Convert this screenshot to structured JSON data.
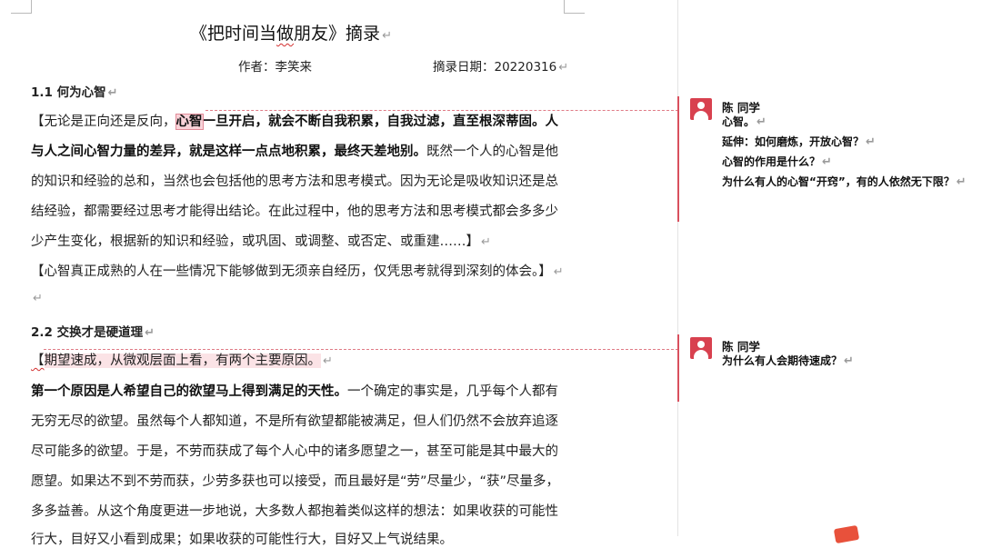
{
  "doc": {
    "title_pre": "《把时间当",
    "title_wavy": "做",
    "title_post": "朋友》摘录",
    "pilcrow": "↵",
    "author": "作者：李笑来",
    "date": "摘录日期：20220316"
  },
  "sections": {
    "s1_heading": "1.1 何为心智",
    "s2_heading": "2.2 交换才是硬道理"
  },
  "lines": {
    "l1a": "【无论是正向还是反向，",
    "l1b": "心智",
    "l1c": "一旦开启，就会不断自我积累，自我过滤，直至根深蒂固。人",
    "l2a": "与人之间心智力量的差异，就是这样一点点地积累，最终天差地别。",
    "l2b": "既然一个人的心智是他",
    "l3": "的知识和经验的总和，当然也会包括他的思考方法和思考模式。因为无论是吸收知识还是总",
    "l4": "结经验，都需要经过思考才能得出结论。在此过程中，他的思考方法和思考模式都会多多少",
    "l5": "少产生变化，根据新的知识和经验，或巩固、或调整、或否定、或重建……】",
    "l6": "【心智真正成熟的人在一些情况下能够做到无须亲自经历，仅凭思考就得到深刻的体会。】",
    "l7a": "【",
    "l7b": "期望速成，从微观层面上看，有两个主要原因。",
    "l8a": "第一个原因是人希望自己的欲望马上得到满足的天性。",
    "l8b": "一个确定的事实是，几乎每个人都有",
    "l9": "无穷无尽的欲望。虽然每个人都知道，不是所有欲望都能被满足，但人们仍然不会放弃追逐",
    "l10": "尽可能多的欲望。于是，不劳而获成了每个人心中的诸多愿望之一，甚至可能是其中最大的",
    "l11": "愿望。如果达不到不劳而获，少劳多获也可以接受，而且最好是“劳”尽量少，“获”尽量多，",
    "l12": "多多益善。从这个角度更进一步地说，大多数人都抱着类似这样的想法：如果收获的可能性",
    "l13": "行大，目好又小看到成果；如果收获的可能性行大，目好又上气说结果。"
  },
  "comments": [
    {
      "author": "陈 同学",
      "lines": [
        "心智。",
        "延伸：如何磨炼，开放心智？",
        "心智的作用是什么？",
        "为什么有人的心智“开窍”，有的人依然无下限？"
      ]
    },
    {
      "author": "陈 同学",
      "lines": [
        "为什么有人会期待速成？"
      ]
    }
  ],
  "colors": {
    "comment_accent": "#d9505e",
    "highlight": "#f9d3d9",
    "avatar": "#d8414f"
  }
}
